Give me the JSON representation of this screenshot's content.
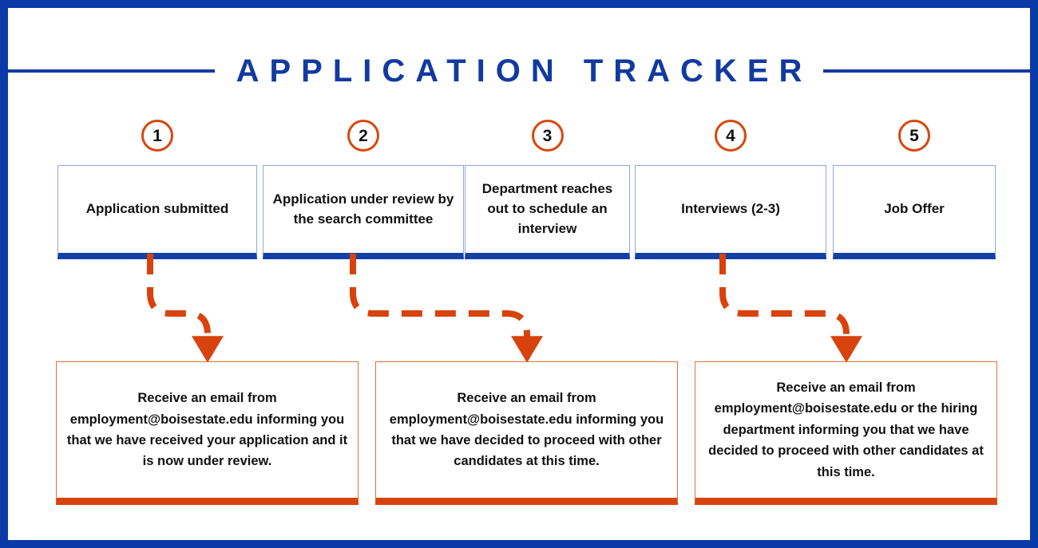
{
  "header": {
    "title": "APPLICATION TRACKER"
  },
  "colors": {
    "frame_blue": "#0A39A8",
    "title_blue": "#123AA0",
    "box_border_blue": "#8FA7DC",
    "box_bar_blue": "#1340A8",
    "accent_orange": "#D8470F",
    "email_bar_orange": "#D8430D",
    "text_black": "#111111",
    "background": "#FFFFFF"
  },
  "steps": [
    {
      "number": "1",
      "label": "Application submitted"
    },
    {
      "number": "2",
      "label": "Application under review by the search committee"
    },
    {
      "number": "3",
      "label": "Department reaches out to schedule an interview"
    },
    {
      "number": "4",
      "label": "Interviews (2-3)"
    },
    {
      "number": "5",
      "label": "Job Offer"
    }
  ],
  "outcomes": [
    {
      "text": "Receive an email from employment@boisestate.edu informing you that we have received your application and it is now under review."
    },
    {
      "text": "Receive an email from employment@boisestate.edu informing you that we have decided to proceed with other candidates at this time."
    },
    {
      "text": "Receive an email from employment@boisestate.edu or the hiring department informing you that we have decided to proceed with other candidates at this time."
    }
  ],
  "connectors": [
    {
      "from_step": "1",
      "to_outcome": "1",
      "style": "dashed-elbow-arrow"
    },
    {
      "from_step": "2",
      "to_outcome": "2",
      "style": "dashed-elbow-arrow"
    },
    {
      "from_step": "4",
      "to_outcome": "3",
      "style": "dashed-elbow-arrow"
    }
  ]
}
